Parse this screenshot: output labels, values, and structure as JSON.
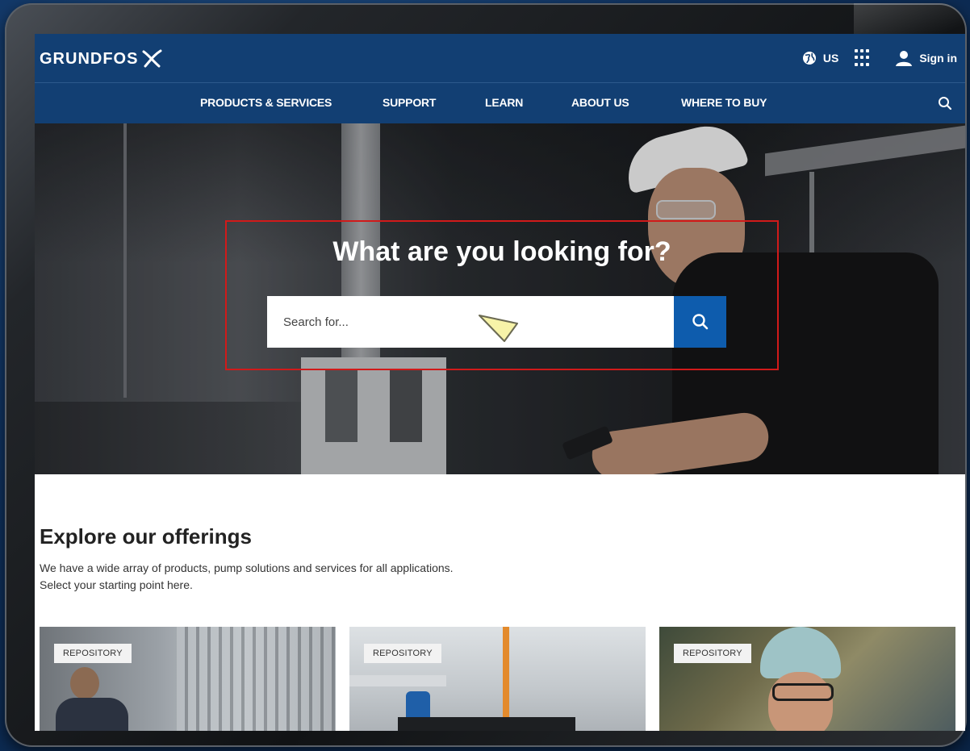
{
  "header": {
    "logo_text": "GRUNDFOS",
    "region": "US",
    "sign_in": "Sign in"
  },
  "nav": {
    "items": [
      {
        "label": "PRODUCTS & SERVICES"
      },
      {
        "label": "SUPPORT"
      },
      {
        "label": "LEARN"
      },
      {
        "label": "ABOUT US"
      },
      {
        "label": "WHERE TO BUY"
      }
    ]
  },
  "hero": {
    "title": "What are you looking for?",
    "search_placeholder": "Search for..."
  },
  "explore": {
    "title": "Explore our offerings",
    "description_lines": [
      "We have a wide array of products, pump solutions and services for all applications.",
      "Select your starting point here."
    ],
    "cards": [
      {
        "badge": "REPOSITORY"
      },
      {
        "badge": "REPOSITORY"
      },
      {
        "badge": "REPOSITORY"
      }
    ]
  },
  "colors": {
    "header_blue": "#123f73",
    "search_button_blue": "#0e5cad",
    "highlight_red": "#d11a1a"
  },
  "icons": [
    "globe-icon",
    "app-grid-icon",
    "user-icon",
    "search-icon",
    "pointer-cursor-icon",
    "grundfos-logo-mark"
  ]
}
